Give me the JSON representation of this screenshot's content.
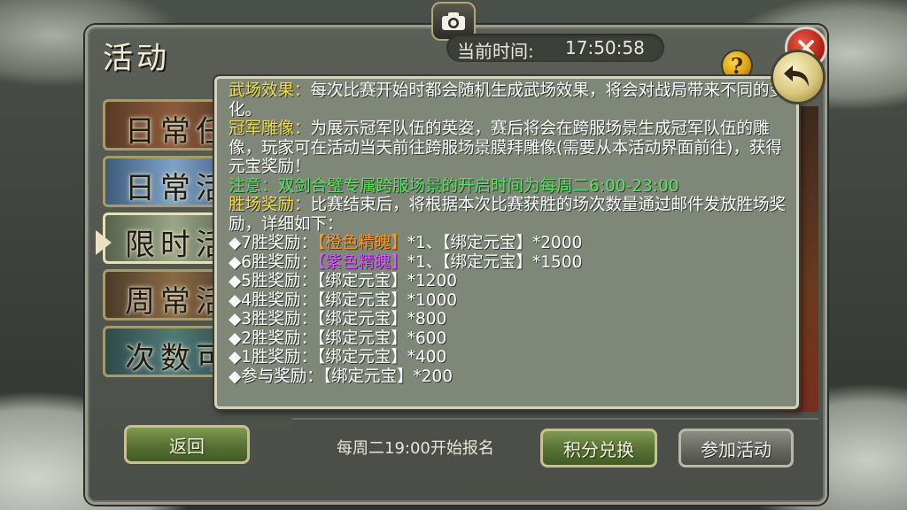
{
  "window": {
    "title": "活动"
  },
  "header": {
    "time_label": "当前时间:",
    "time_value": "17:50:58"
  },
  "icons": {
    "camera": "camera-icon",
    "close": "close-icon",
    "help": "question-icon",
    "back": "curved-arrow-icon"
  },
  "tabs": [
    {
      "label": "日常任"
    },
    {
      "label": "日常活"
    },
    {
      "label": "限时活"
    },
    {
      "label": "周常活"
    },
    {
      "label": "次数可"
    }
  ],
  "popup": {
    "p1_heading": "武场效果：",
    "p1_text": "每次比赛开始时都会随机生成武场效果，将会对战局带来不同的变化。",
    "p2_heading": "冠军雕像：",
    "p2_text": "为展示冠军队伍的英姿，赛后将会在跨服场景生成冠军队伍的雕像，玩家可在活动当天前往跨服场景膜拜雕像(需要从本活动界面前往)，获得元宝奖励！",
    "p3_text": "注意：双剑合璧专属跨服场景的开启时间为每周二6:00-23:00",
    "p4_heading": "胜场奖励：",
    "p4_text": "比赛结束后，将根据本次比赛获胜的场次数量通过邮件发放胜场奖励，详细如下：",
    "rewards": [
      {
        "prefix": "◆7胜奖励：",
        "special": "【橙色精魄】",
        "rest": "*1、【绑定元宝】*2000"
      },
      {
        "prefix": "◆6胜奖励：",
        "special": "【紫色精魄】",
        "rest": "*1、【绑定元宝】*1500"
      },
      {
        "prefix": "◆5胜奖励：",
        "special": "",
        "rest": "【绑定元宝】*1200"
      },
      {
        "prefix": "◆4胜奖励：",
        "special": "",
        "rest": "【绑定元宝】*1000"
      },
      {
        "prefix": "◆3胜奖励：",
        "special": "",
        "rest": "【绑定元宝】*800"
      },
      {
        "prefix": "◆2胜奖励：",
        "special": "",
        "rest": "【绑定元宝】*600"
      },
      {
        "prefix": "◆1胜奖励：",
        "special": "",
        "rest": "【绑定元宝】*400"
      },
      {
        "prefix": "◆参与奖励：",
        "special": "",
        "rest": "【绑定元宝】*200"
      }
    ]
  },
  "footer": {
    "back_label": "返回",
    "signup_note": "每周二19:00开始报名",
    "points_label": "积分兑换",
    "join_label": "参加活动"
  },
  "colors": {
    "heading_yellow": "#f0dd4a",
    "notice_green": "#57e35f",
    "orange_item": "#ff9a1f",
    "purple_item": "#d65cff",
    "popup_bg": "#7e8778"
  }
}
